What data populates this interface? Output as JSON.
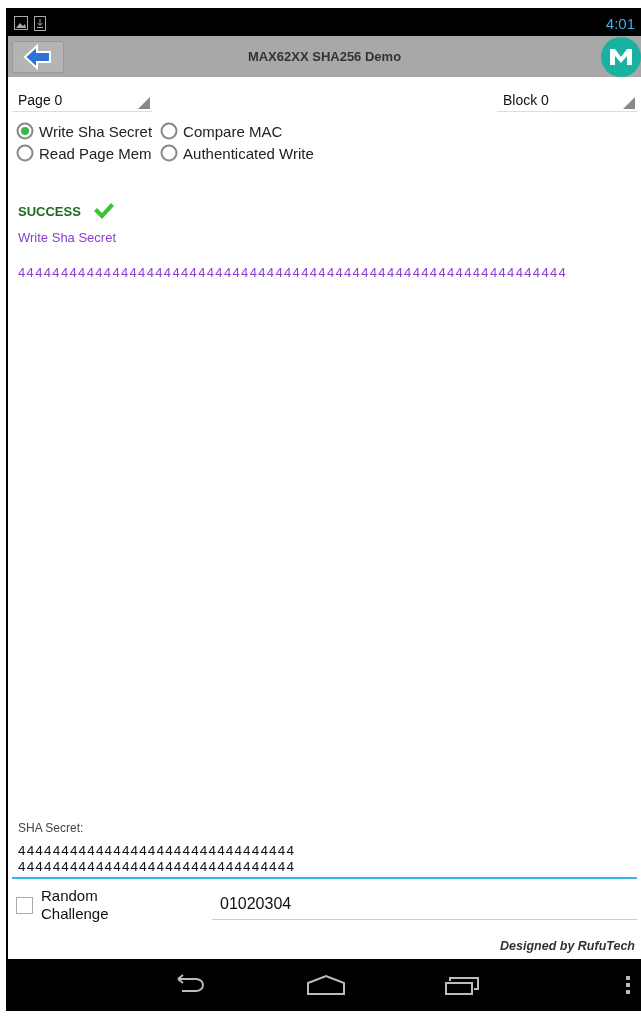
{
  "status_bar": {
    "time": "4:01"
  },
  "action_bar": {
    "title": "MAX62XX SHA256 Demo"
  },
  "spinners": [
    {
      "value": "Page 0"
    },
    {
      "value": "Block 0"
    }
  ],
  "modes": [
    {
      "label": "Write Sha Secret",
      "selected": true
    },
    {
      "label": "Compare MAC",
      "selected": false
    },
    {
      "label": "Read Page Mem",
      "selected": false
    },
    {
      "label": "Authenticated Write",
      "selected": false
    }
  ],
  "result": {
    "status": "SUCCESS",
    "operation": "Write Sha Secret",
    "data": "4444444444444444444444444444444444444444444444444444444444444444"
  },
  "secret": {
    "label": "SHA Secret:",
    "value": "4444444444444444444444444444444444444444444444444444444444444444"
  },
  "random_challenge": {
    "label": "Random Challenge",
    "checked": false
  },
  "challenge": {
    "value": "01020304"
  },
  "footer": "Designed by RufuTech"
}
